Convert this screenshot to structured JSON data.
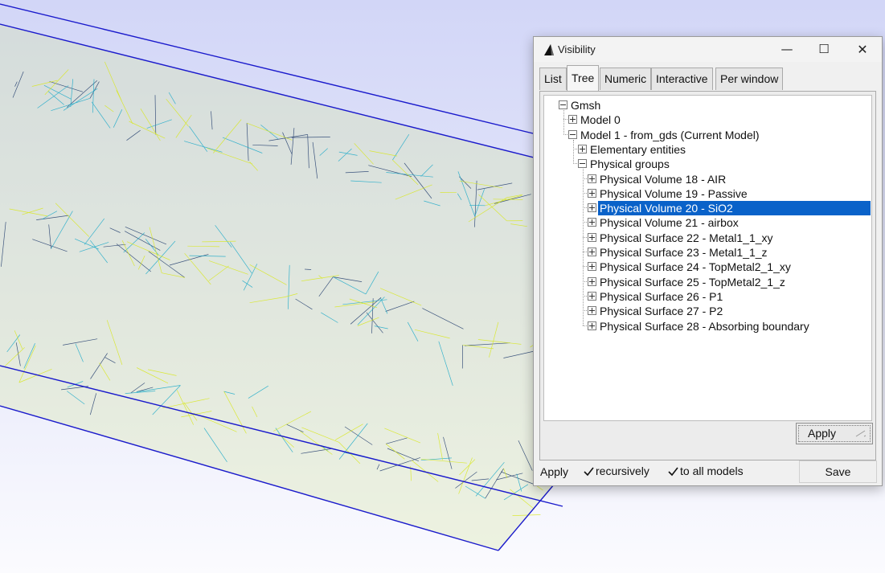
{
  "window": {
    "title": "Visibility",
    "controls": {
      "minimize": "—",
      "maximize": "☐",
      "close": "✕"
    }
  },
  "tabs": [
    {
      "label": "List",
      "active": false
    },
    {
      "label": "Tree",
      "active": true
    },
    {
      "label": "Numeric",
      "active": false
    },
    {
      "label": "Interactive",
      "active": false
    },
    {
      "label": "Per window",
      "active": false
    }
  ],
  "tree": [
    {
      "label": "Gmsh",
      "depth": 0,
      "toggle": "minus",
      "selected": false
    },
    {
      "label": "Model 0",
      "depth": 1,
      "toggle": "plus",
      "selected": false
    },
    {
      "label": "Model 1 - from_gds (Current Model)",
      "depth": 1,
      "toggle": "minus",
      "selected": false
    },
    {
      "label": "Elementary entities",
      "depth": 2,
      "toggle": "plus",
      "selected": false
    },
    {
      "label": "Physical groups",
      "depth": 2,
      "toggle": "minus",
      "selected": false
    },
    {
      "label": "Physical Volume 18 - AIR",
      "depth": 3,
      "toggle": "plus",
      "selected": false
    },
    {
      "label": "Physical Volume 19 - Passive",
      "depth": 3,
      "toggle": "plus",
      "selected": false
    },
    {
      "label": "Physical Volume 20 - SiO2",
      "depth": 3,
      "toggle": "plus",
      "selected": true
    },
    {
      "label": "Physical Volume 21 - airbox",
      "depth": 3,
      "toggle": "plus",
      "selected": false
    },
    {
      "label": "Physical Surface 22 - Metal1_1_xy",
      "depth": 3,
      "toggle": "plus",
      "selected": false
    },
    {
      "label": "Physical Surface 23 - Metal1_1_z",
      "depth": 3,
      "toggle": "plus",
      "selected": false
    },
    {
      "label": "Physical Surface 24 - TopMetal2_1_xy",
      "depth": 3,
      "toggle": "plus",
      "selected": false
    },
    {
      "label": "Physical Surface 25 - TopMetal2_1_z",
      "depth": 3,
      "toggle": "plus",
      "selected": false
    },
    {
      "label": "Physical Surface 26 - P1",
      "depth": 3,
      "toggle": "plus",
      "selected": false
    },
    {
      "label": "Physical Surface 27 - P2",
      "depth": 3,
      "toggle": "plus",
      "selected": false
    },
    {
      "label": "Physical Surface 28 - Absorbing boundary",
      "depth": 3,
      "toggle": "plus",
      "selected": false
    }
  ],
  "buttons": {
    "apply_inner": "Apply",
    "save": "Save"
  },
  "bottom": {
    "apply_label": "Apply",
    "recursively": {
      "label": "recursively",
      "checked": true
    },
    "to_all_models": {
      "label": "to all models",
      "checked": true
    }
  },
  "colors": {
    "selection": "#0a62c9",
    "mesh_box": "#1a1acc",
    "mesh_dark": "#1f3a6b",
    "mesh_cyan": "#18a8c8",
    "mesh_yellow": "#d8e81a"
  }
}
